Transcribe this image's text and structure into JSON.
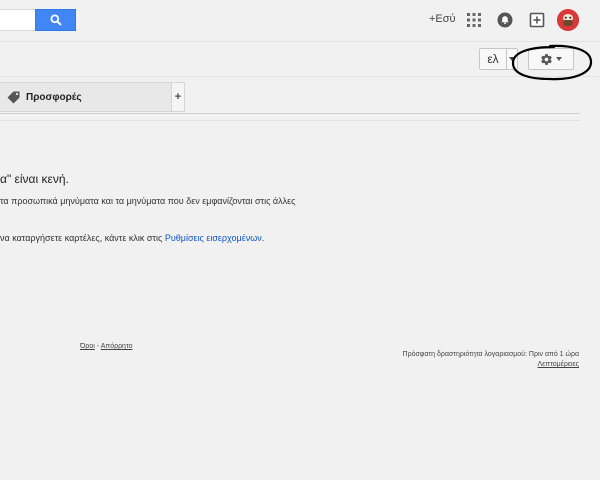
{
  "header": {
    "plus_you": "+Εσύ",
    "icons": {
      "search": "search-icon",
      "apps": "apps-grid-icon",
      "notifications": "notifications-icon",
      "share": "share-plus-icon",
      "avatar": "avatar"
    }
  },
  "toolbar": {
    "language_label": "ελ",
    "settings_icon": "gear-icon"
  },
  "tabs": [
    {
      "label": "Προσφορές",
      "icon": "tag-icon"
    }
  ],
  "add_tab_label": "+",
  "main": {
    "empty_message": "α\" είναι κενή.",
    "info_line": "τα προσωπικά μηνύματα και τα μηνύματα που δεν εμφανίζονται στις άλλες",
    "settings_prefix": "να καταργήσετε καρτέλες, κάντε κλικ στις",
    "settings_link": "Ρυθμίσεις εισερχομένων",
    "settings_suffix": "."
  },
  "footer": {
    "terms": "Όροι",
    "separator": " - ",
    "privacy": "Απόρρητο",
    "last_activity": "Πρόσφατη δραστηριότητα λογαριασμού: Πριν από 1 ώρα",
    "details": "Λεπτομέρειες"
  },
  "colors": {
    "search_button": "#4285f4",
    "link": "#1155cc",
    "annotation_circle": "#000000",
    "avatar": "#d8383a"
  }
}
